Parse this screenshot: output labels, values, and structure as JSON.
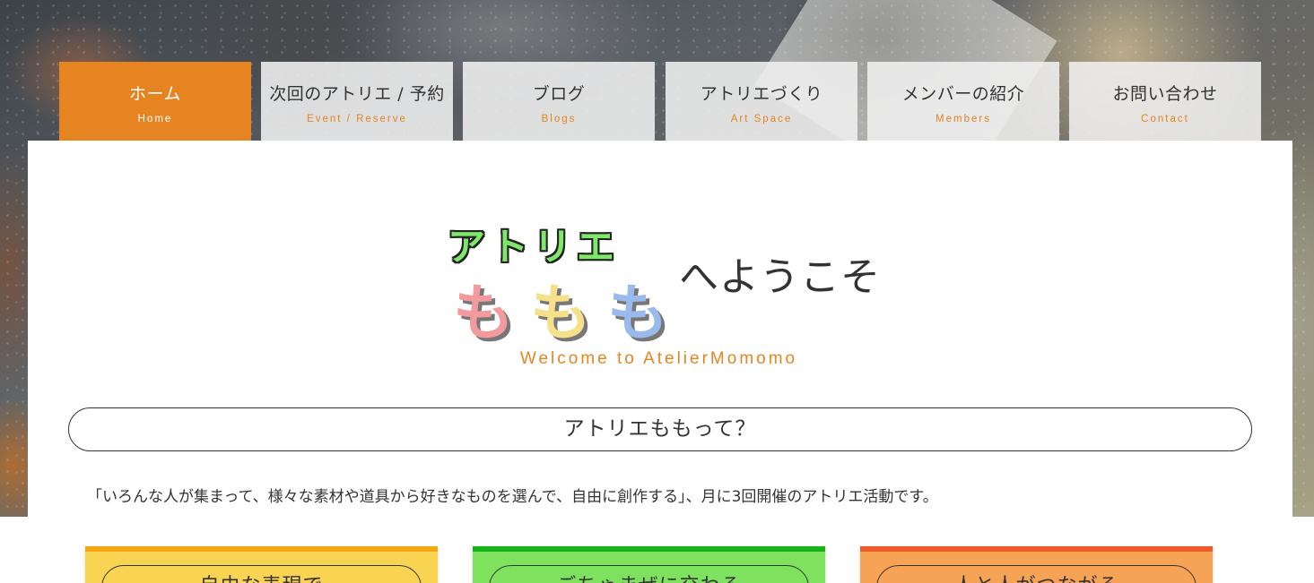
{
  "nav": {
    "items": [
      {
        "jp": "ホーム",
        "en": "Home"
      },
      {
        "jp": "次回のアトリエ / 予約",
        "en": "Event / Reserve"
      },
      {
        "jp": "ブログ",
        "en": "Blogs"
      },
      {
        "jp": "アトリエづくり",
        "en": "Art Space"
      },
      {
        "jp": "メンバーの紹介",
        "en": "Members"
      },
      {
        "jp": "お問い合わせ",
        "en": "Contact"
      }
    ],
    "active_color": "#e58421"
  },
  "hero": {
    "logo_line1": [
      "ア",
      "ト",
      "リ",
      "エ"
    ],
    "logo_line2": [
      "も",
      "も",
      "も"
    ],
    "welcome_suffix": "へようこそ",
    "welcome_en": "Welcome to AtelierMomomo"
  },
  "about": {
    "heading": "アトリエももって？",
    "text": "「いろんな人が集まって、様々な素材や道具から好きなものを選んで、自由に創作する」、月に3回開催のアトリエ活動です。"
  },
  "features": [
    {
      "title": "自由な表現で",
      "bg_color": "#f8d452",
      "top_color": "#f3a712"
    },
    {
      "title": "ごちゃまぜに交わる",
      "bg_color": "#7ee25e",
      "top_color": "#17b219"
    },
    {
      "title": "人と人がつながる",
      "bg_color": "#f7a356",
      "top_color": "#ee5a2c"
    }
  ]
}
